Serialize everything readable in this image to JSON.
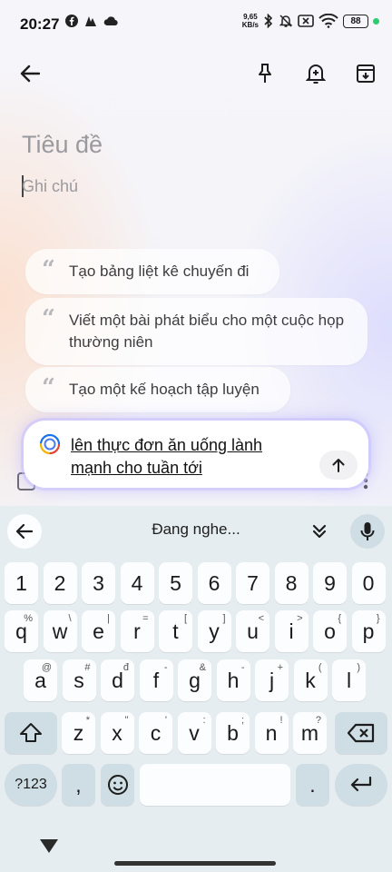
{
  "status": {
    "time": "20:27",
    "speed_value": "9,65",
    "speed_unit": "KB/s",
    "battery": "88"
  },
  "note": {
    "title_placeholder": "Tiêu đề",
    "body_placeholder": "Ghi chú"
  },
  "suggestions": [
    "Tạo bảng liệt kê chuyến đi",
    "Viết một bài phát biểu cho một cuộc họp thường niên",
    "Tạo một kế hoạch tập luyện"
  ],
  "prompt": {
    "text": "lên thực đơn ăn uống lành mạnh cho tuần tới"
  },
  "keyboard": {
    "status": "Đang nghe...",
    "row_numbers": [
      "1",
      "2",
      "3",
      "4",
      "5",
      "6",
      "7",
      "8",
      "9",
      "0"
    ],
    "row1": [
      {
        "k": "q",
        "h": "%"
      },
      {
        "k": "w",
        "h": "\\"
      },
      {
        "k": "e",
        "h": "|"
      },
      {
        "k": "r",
        "h": "="
      },
      {
        "k": "t",
        "h": "["
      },
      {
        "k": "y",
        "h": "]"
      },
      {
        "k": "u",
        "h": "<"
      },
      {
        "k": "i",
        "h": ">"
      },
      {
        "k": "o",
        "h": "{"
      },
      {
        "k": "p",
        "h": "}"
      }
    ],
    "row2": [
      {
        "k": "a",
        "h": "@"
      },
      {
        "k": "s",
        "h": "#"
      },
      {
        "k": "d",
        "h": "đ"
      },
      {
        "k": "f",
        "h": "-"
      },
      {
        "k": "g",
        "h": "&"
      },
      {
        "k": "h",
        "h": "-"
      },
      {
        "k": "j",
        "h": "+"
      },
      {
        "k": "k",
        "h": "("
      },
      {
        "k": "l",
        "h": ")"
      }
    ],
    "row3": [
      {
        "k": "z",
        "h": "*"
      },
      {
        "k": "x",
        "h": "\""
      },
      {
        "k": "c",
        "h": "'"
      },
      {
        "k": "v",
        "h": ":"
      },
      {
        "k": "b",
        "h": ";"
      },
      {
        "k": "n",
        "h": "!"
      },
      {
        "k": "m",
        "h": "?"
      }
    ],
    "sym_label": "?123",
    "comma": ",",
    "period": "."
  }
}
